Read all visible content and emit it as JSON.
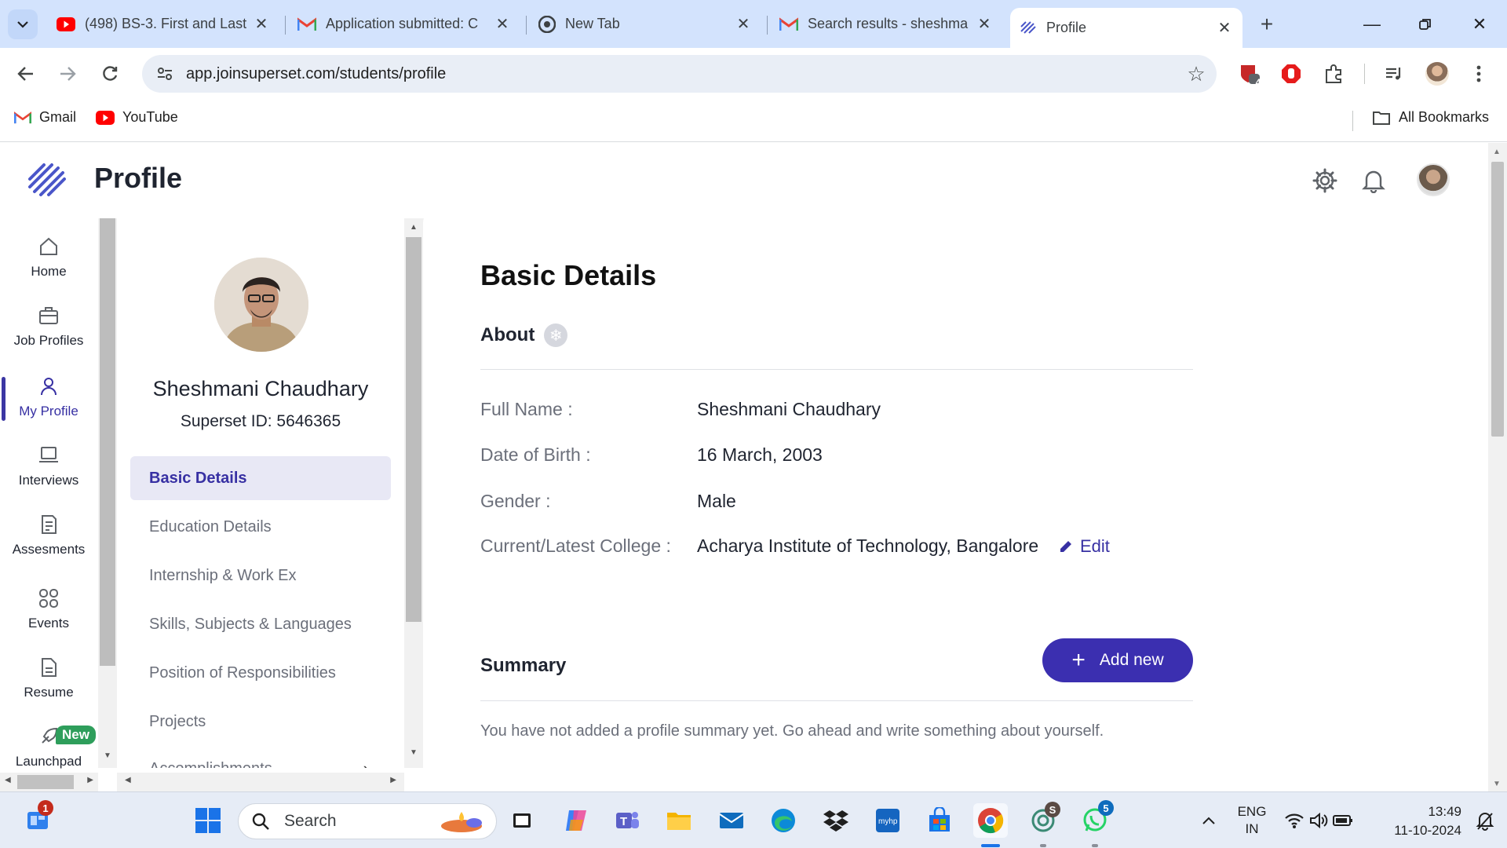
{
  "browser": {
    "tabs": [
      {
        "title": "(498) BS-3. First and Last",
        "icon": "youtube-icon"
      },
      {
        "title": "Application submitted: C",
        "icon": "gmail-icon"
      },
      {
        "title": "New Tab",
        "icon": "chrome-icon"
      },
      {
        "title": "Search results - sheshma",
        "icon": "gmail-icon"
      },
      {
        "title": "Profile",
        "icon": "superset-icon"
      }
    ],
    "url": "app.joinsuperset.com/students/profile",
    "extension_badge": "4",
    "bookmarks": [
      {
        "label": "Gmail",
        "icon": "gmail-icon"
      },
      {
        "label": "YouTube",
        "icon": "youtube-icon"
      }
    ],
    "all_bookmarks": "All Bookmarks"
  },
  "app": {
    "title": "Profile",
    "nav": [
      {
        "label": "Home",
        "icon": "home-icon"
      },
      {
        "label": "Job Profiles",
        "icon": "briefcase-icon"
      },
      {
        "label": "My Profile",
        "icon": "user-icon"
      },
      {
        "label": "Interviews",
        "icon": "laptop-icon"
      },
      {
        "label": "Assesments",
        "icon": "document-icon"
      },
      {
        "label": "Events",
        "icon": "grid-icon"
      },
      {
        "label": "Resume",
        "icon": "file-icon"
      },
      {
        "label": "Launchpad",
        "icon": "rocket-icon"
      }
    ],
    "new_badge": "New",
    "profile": {
      "name": "Sheshmani Chaudhary",
      "superset_id": "Superset ID: 5646365",
      "sections": [
        "Basic Details",
        "Education Details",
        "Internship & Work Ex",
        "Skills, Subjects & Languages",
        "Position of Responsibilities",
        "Projects",
        "Accomplishments"
      ]
    },
    "main": {
      "heading": "Basic Details",
      "about_title": "About",
      "details": [
        {
          "label": "Full Name :",
          "value": "Sheshmani Chaudhary"
        },
        {
          "label": "Date of Birth :",
          "value": "16 March, 2003"
        },
        {
          "label": "Gender :",
          "value": "Male"
        },
        {
          "label": "Current/Latest College :",
          "value": "Acharya Institute of Technology, Bangalore"
        }
      ],
      "edit_label": "Edit",
      "summary_title": "Summary",
      "add_new_label": "Add new",
      "summary_empty": "You have not added a profile summary yet. Go ahead and write something about yourself."
    }
  },
  "taskbar": {
    "start_badge": "1",
    "search_label": "Search",
    "chatgpt_badge": "S",
    "whatsapp_badge": "5",
    "lang_line1": "ENG",
    "lang_line2": "IN",
    "time": "13:49",
    "date": "11-10-2024"
  },
  "colors": {
    "accent": "#3b2fb0",
    "active_nav": "#3730a3",
    "tab_bar": "#d3e3fd",
    "new_badge": "#2e9e5b"
  }
}
